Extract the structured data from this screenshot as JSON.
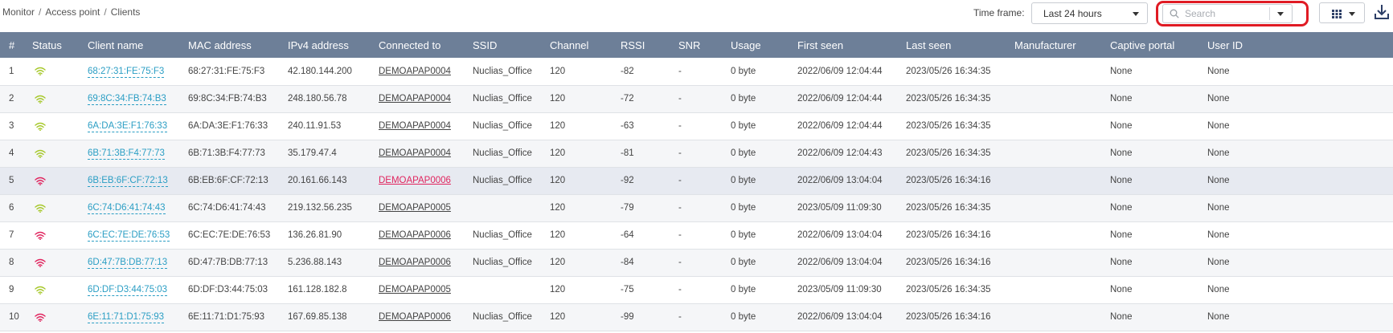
{
  "breadcrumb": [
    "Monitor",
    "Access point",
    "Clients"
  ],
  "toolbar": {
    "timeframe_label": "Time frame:",
    "timeframe_value": "Last 24 hours",
    "search_placeholder": "Search",
    "search_value": ""
  },
  "colors": {
    "header_bg": "#6d7f98",
    "link": "#2b9ec4",
    "signal_good": "#a6c82a",
    "signal_poor": "#e0245e",
    "highlight": "#e01b24"
  },
  "table": {
    "columns": [
      "#",
      "Status",
      "Client name",
      "MAC address",
      "IPv4 address",
      "Connected to",
      "SSID",
      "Channel",
      "RSSI",
      "SNR",
      "Usage",
      "First seen",
      "Last seen",
      "Manufacturer",
      "Captive portal",
      "User ID"
    ],
    "rows": [
      {
        "num": "1",
        "signal": "good",
        "client": "68:27:31:FE:75:F3",
        "mac": "68:27:31:FE:75:F3",
        "ipv4": "42.180.144.200",
        "ap": "DEMOAPAP0004",
        "ssid": "Nuclias_Office",
        "channel": "120",
        "rssi": "-82",
        "snr": "-",
        "usage": "0 byte",
        "first_seen": "2022/06/09 12:04:44",
        "last_seen": "2023/05/26 16:34:35",
        "manufacturer": "",
        "captive": "None",
        "user_id": "None"
      },
      {
        "num": "2",
        "signal": "good",
        "client": "69:8C:34:FB:74:B3",
        "mac": "69:8C:34:FB:74:B3",
        "ipv4": "248.180.56.78",
        "ap": "DEMOAPAP0004",
        "ssid": "Nuclias_Office",
        "channel": "120",
        "rssi": "-72",
        "snr": "-",
        "usage": "0 byte",
        "first_seen": "2022/06/09 12:04:44",
        "last_seen": "2023/05/26 16:34:35",
        "manufacturer": "",
        "captive": "None",
        "user_id": "None"
      },
      {
        "num": "3",
        "signal": "good",
        "client": "6A:DA:3E:F1:76:33",
        "mac": "6A:DA:3E:F1:76:33",
        "ipv4": "240.11.91.53",
        "ap": "DEMOAPAP0004",
        "ssid": "Nuclias_Office",
        "channel": "120",
        "rssi": "-63",
        "snr": "-",
        "usage": "0 byte",
        "first_seen": "2022/06/09 12:04:44",
        "last_seen": "2023/05/26 16:34:35",
        "manufacturer": "",
        "captive": "None",
        "user_id": "None"
      },
      {
        "num": "4",
        "signal": "good",
        "client": "6B:71:3B:F4:77:73",
        "mac": "6B:71:3B:F4:77:73",
        "ipv4": "35.179.47.4",
        "ap": "DEMOAPAP0004",
        "ssid": "Nuclias_Office",
        "channel": "120",
        "rssi": "-81",
        "snr": "-",
        "usage": "0 byte",
        "first_seen": "2022/06/09 12:04:43",
        "last_seen": "2023/05/26 16:34:35",
        "manufacturer": "",
        "captive": "None",
        "user_id": "None"
      },
      {
        "num": "5",
        "signal": "poor",
        "client": "6B:EB:6F:CF:72:13",
        "mac": "6B:EB:6F:CF:72:13",
        "ipv4": "20.161.66.143",
        "ap": "DEMOAPAP0006",
        "ap_alert": true,
        "ssid": "Nuclias_Office",
        "channel": "120",
        "rssi": "-92",
        "snr": "-",
        "usage": "0 byte",
        "first_seen": "2022/06/09 13:04:04",
        "last_seen": "2023/05/26 16:34:16",
        "manufacturer": "",
        "captive": "None",
        "user_id": "None",
        "selected": true
      },
      {
        "num": "6",
        "signal": "good",
        "client": "6C:74:D6:41:74:43",
        "mac": "6C:74:D6:41:74:43",
        "ipv4": "219.132.56.235",
        "ap": "DEMOAPAP0005",
        "ssid": "",
        "channel": "120",
        "rssi": "-79",
        "snr": "-",
        "usage": "0 byte",
        "first_seen": "2023/05/09 11:09:30",
        "last_seen": "2023/05/26 16:34:35",
        "manufacturer": "",
        "captive": "None",
        "user_id": "None"
      },
      {
        "num": "7",
        "signal": "poor",
        "client": "6C:EC:7E:DE:76:53",
        "mac": "6C:EC:7E:DE:76:53",
        "ipv4": "136.26.81.90",
        "ap": "DEMOAPAP0006",
        "ssid": "Nuclias_Office",
        "channel": "120",
        "rssi": "-64",
        "snr": "-",
        "usage": "0 byte",
        "first_seen": "2022/06/09 13:04:04",
        "last_seen": "2023/05/26 16:34:16",
        "manufacturer": "",
        "captive": "None",
        "user_id": "None"
      },
      {
        "num": "8",
        "signal": "poor",
        "client": "6D:47:7B:DB:77:13",
        "mac": "6D:47:7B:DB:77:13",
        "ipv4": "5.236.88.143",
        "ap": "DEMOAPAP0006",
        "ssid": "Nuclias_Office",
        "channel": "120",
        "rssi": "-84",
        "snr": "-",
        "usage": "0 byte",
        "first_seen": "2022/06/09 13:04:04",
        "last_seen": "2023/05/26 16:34:16",
        "manufacturer": "",
        "captive": "None",
        "user_id": "None"
      },
      {
        "num": "9",
        "signal": "good",
        "client": "6D:DF:D3:44:75:03",
        "mac": "6D:DF:D3:44:75:03",
        "ipv4": "161.128.182.8",
        "ap": "DEMOAPAP0005",
        "ssid": "",
        "channel": "120",
        "rssi": "-75",
        "snr": "-",
        "usage": "0 byte",
        "first_seen": "2023/05/09 11:09:30",
        "last_seen": "2023/05/26 16:34:35",
        "manufacturer": "",
        "captive": "None",
        "user_id": "None"
      },
      {
        "num": "10",
        "signal": "poor",
        "client": "6E:11:71:D1:75:93",
        "mac": "6E:11:71:D1:75:93",
        "ipv4": "167.69.85.138",
        "ap": "DEMOAPAP0006",
        "ssid": "Nuclias_Office",
        "channel": "120",
        "rssi": "-99",
        "snr": "-",
        "usage": "0 byte",
        "first_seen": "2022/06/09 13:04:04",
        "last_seen": "2023/05/26 16:34:16",
        "manufacturer": "",
        "captive": "None",
        "user_id": "None"
      }
    ]
  }
}
